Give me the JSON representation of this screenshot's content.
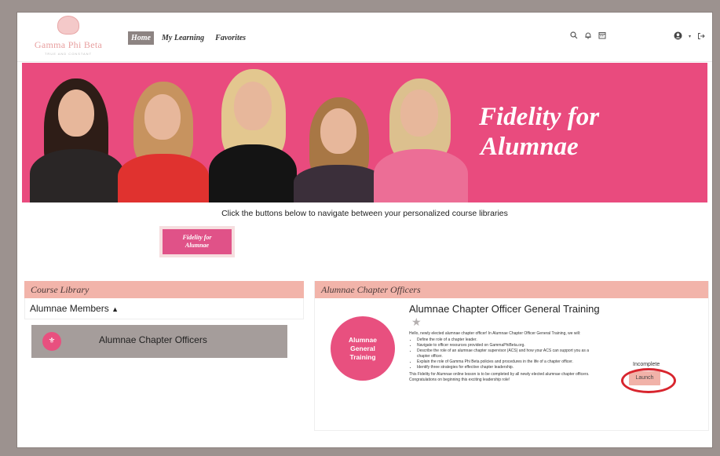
{
  "header": {
    "logo_name": "Gamma Phi Beta",
    "logo_tagline": "TRUE AND CONSTANT",
    "nav": [
      {
        "label": "Home",
        "active": true
      },
      {
        "label": "My Learning",
        "active": false
      },
      {
        "label": "Favorites",
        "active": false
      }
    ],
    "icons": [
      "search-icon",
      "bell-icon",
      "calendar-icon",
      "user-avatar-icon",
      "caret-down-icon",
      "logout-icon"
    ]
  },
  "banner": {
    "title_line1": "Fidelity for",
    "title_line2": "Alumnae",
    "background": "#e94b7e"
  },
  "navigation_hint": "Click the buttons below to navigate between your personalized course libraries",
  "library_button": {
    "label_line1": "Fidelity for",
    "label_line2": "Alumnae"
  },
  "course_library": {
    "heading": "Course Library",
    "group_label": "Alumnae Members",
    "group_toggle": "▲",
    "items": [
      {
        "label": "Alumnae Chapter Officers",
        "icon": "crest-icon"
      }
    ]
  },
  "course_panel": {
    "heading": "Alumnae Chapter Officers",
    "course_title": "Alumnae Chapter Officer General Training",
    "favorite_icon": "star-icon",
    "badge_line1": "Alumnae",
    "badge_line2": "General",
    "badge_line3": "Training",
    "intro": "Hello, newly elected alumnae chapter officer! In Alumnae Chapter Officer General Training, we will:",
    "bullets": [
      "Define the role of a chapter leader.",
      "Navigate to officer resources provided on GammaPhiBeta.org.",
      "Describe the role of an alumnae chapter supervisor (ACS) and how your ACS can support you as a chapter officer.",
      "Explain the role of Gamma Phi Beta policies and procedures in the life of a chapter officer.",
      "Identify three strategies for effective chapter leadership."
    ],
    "closing": "This Fidelity for Alumnae online lesson is to be completed by all newly elected alumnae chapter officers. Congratulations on beginning this exciting leadership role!",
    "status": "Incomplete",
    "launch_label": "Launch"
  },
  "colors": {
    "accent_pink": "#e8507f",
    "panel_header": "#f2b4aa",
    "nav_active": "#8d8482",
    "highlight_ring": "#d8252e"
  }
}
